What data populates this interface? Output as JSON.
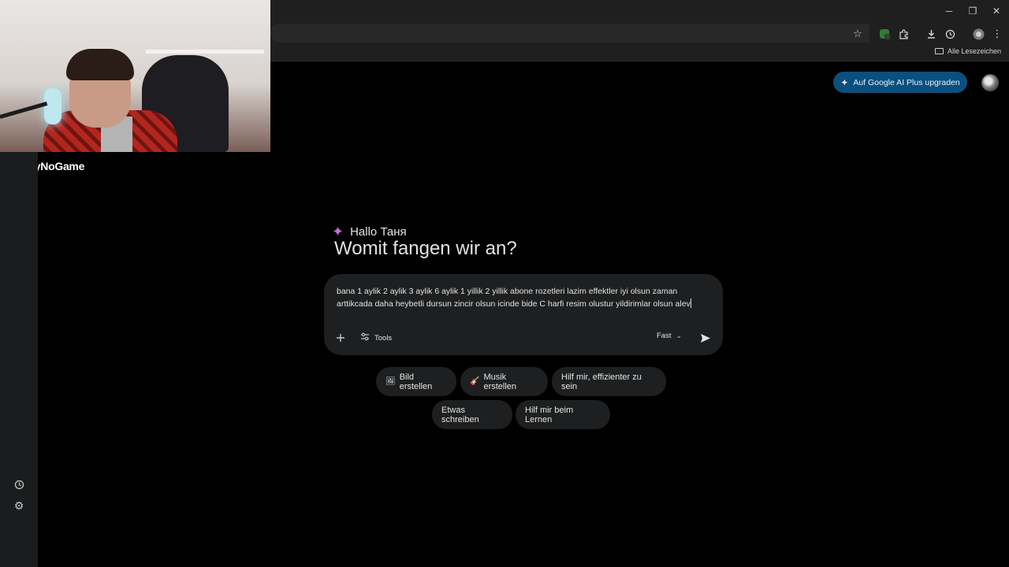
{
  "browser": {
    "window_controls": {
      "minimize": "─",
      "restore": "❐",
      "close": "✕"
    },
    "bookmarks": {
      "all_label": "Alle Lesezeichen"
    },
    "toolbar_icons": [
      "star-icon",
      "extension-badge-icon",
      "extensions-icon",
      "download-icon",
      "history-icon",
      "profile-icon",
      "menu-icon"
    ]
  },
  "overlay": {
    "brand": "ByNoGame"
  },
  "header": {
    "upgrade_label": "Auf Google AI Plus upgraden"
  },
  "greeting": {
    "hello": "Hallo Таня",
    "heading": "Womit fangen wir an?"
  },
  "prompt": {
    "text": "bana 1 aylik 2 aylik 3 aylik 6 aylik 1 yillik 2 yillik abone rozetleri lazim effektler iyi olsun zaman arttikcada daha heybetli dursun zincir olsun icinde bide C harfi resim olustur yildirimlar olsun alev",
    "tools_label": "Tools",
    "mode_label": "Fast"
  },
  "chips": [
    {
      "label": "Bild erstellen",
      "icon": "image-icon"
    },
    {
      "label": "Musik erstellen",
      "icon": "guitar-icon"
    },
    {
      "label": "Hilf mir, effizienter zu sein",
      "icon": ""
    },
    {
      "label": "Etwas schreiben",
      "icon": ""
    },
    {
      "label": "Hilf mir beim Lernen",
      "icon": ""
    }
  ],
  "colors": {
    "page_bg": "#000000",
    "card_bg": "#1e1f20",
    "upgrade_bg": "#0b4f7e",
    "text": "#e3e3e3"
  }
}
